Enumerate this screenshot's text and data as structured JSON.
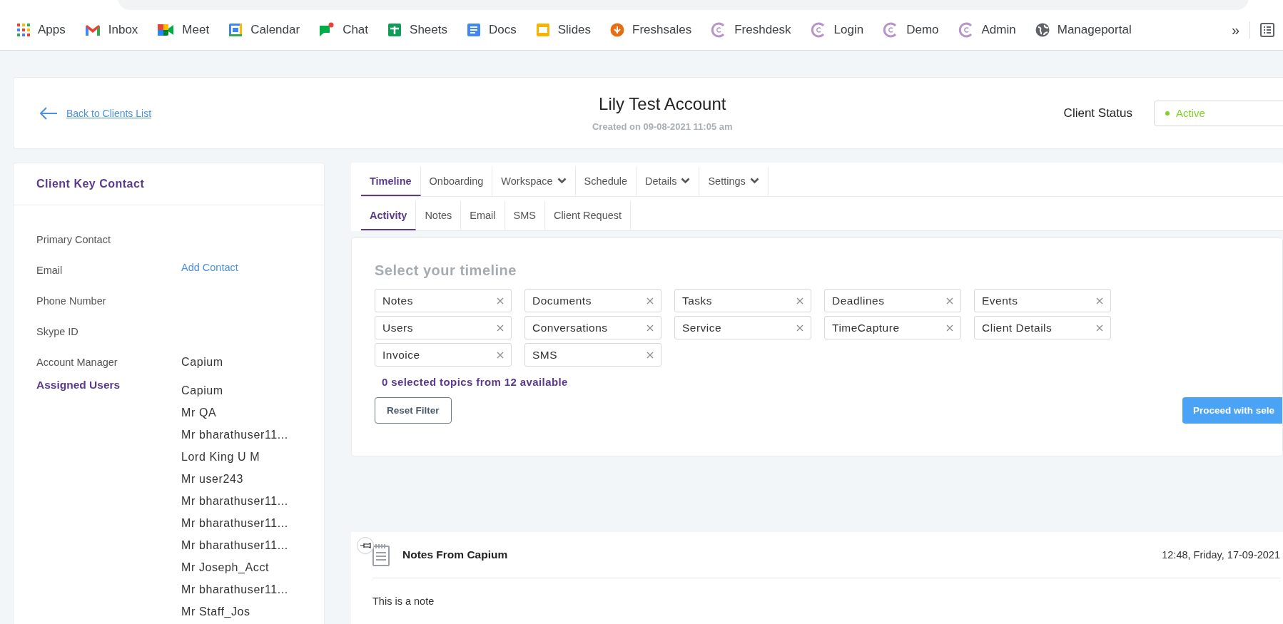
{
  "bookmarks": [
    {
      "label": "Apps",
      "kind": "apps"
    },
    {
      "label": "Inbox",
      "kind": "mail"
    },
    {
      "label": "Meet",
      "kind": "video"
    },
    {
      "label": "Calendar",
      "kind": "calendar"
    },
    {
      "label": "Chat",
      "kind": "chat"
    },
    {
      "label": "Sheets",
      "kind": "sheets"
    },
    {
      "label": "Docs",
      "kind": "docs"
    },
    {
      "label": "Slides",
      "kind": "slides"
    },
    {
      "label": "Freshsales",
      "kind": "orange"
    },
    {
      "label": "Freshdesk",
      "kind": "ring"
    },
    {
      "label": "Login",
      "kind": "ring"
    },
    {
      "label": "Demo",
      "kind": "ring"
    },
    {
      "label": "Admin",
      "kind": "ring"
    },
    {
      "label": "Manageportal",
      "kind": "globe"
    }
  ],
  "bookmarks_more": "»",
  "header": {
    "back_link": "Back to Clients List",
    "title": "Lily Test Account",
    "created": "Created on 09-08-2021 11:05 am",
    "status_label": "Client Status",
    "status_value": "Active"
  },
  "contact_card": {
    "title": "Client Key Contact",
    "rows": [
      {
        "label": "Primary Contact"
      },
      {
        "label": "Email",
        "link": "Add Contact"
      },
      {
        "label": "Phone Number"
      },
      {
        "label": "Skype ID"
      },
      {
        "label": "Account Manager",
        "value": "Capium"
      }
    ],
    "assigned_label": "Assigned Users",
    "assigned_users": [
      "Capium",
      "Mr QA",
      "Mr bharathuser11...",
      "Lord King U M",
      "Mr user243",
      "Mr bharathuser11...",
      "Mr bharathuser11...",
      "Mr bharathuser11...",
      "Mr Joseph_Acct",
      "Mr bharathuser11...",
      "Mr Staff_Jos"
    ]
  },
  "tabs": [
    {
      "label": "Timeline",
      "selected": true,
      "dropdown": false
    },
    {
      "label": "Onboarding",
      "selected": false,
      "dropdown": false
    },
    {
      "label": "Workspace",
      "selected": false,
      "dropdown": true
    },
    {
      "label": "Schedule",
      "selected": false,
      "dropdown": false
    },
    {
      "label": "Details",
      "selected": false,
      "dropdown": true
    },
    {
      "label": "Settings",
      "selected": false,
      "dropdown": true
    }
  ],
  "subtabs": [
    {
      "label": "Activity",
      "selected": true
    },
    {
      "label": "Notes",
      "selected": false
    },
    {
      "label": "Email",
      "selected": false
    },
    {
      "label": "SMS",
      "selected": false
    },
    {
      "label": "Client Request",
      "selected": false
    }
  ],
  "timeline": {
    "title": "Select your timeline",
    "chips": [
      "Notes",
      "Documents",
      "Tasks",
      "Deadlines",
      "Events",
      "Users",
      "Conversations",
      "Service",
      "TimeCapture",
      "Client Details",
      "Invoice",
      "SMS"
    ],
    "summary": "0 selected topics from 12 available",
    "reset": "Reset Filter",
    "proceed": "Proceed with sele"
  },
  "note": {
    "title": "Notes From Capium",
    "time": "12:48, Friday, 17-09-2021",
    "body": "This is a note"
  }
}
